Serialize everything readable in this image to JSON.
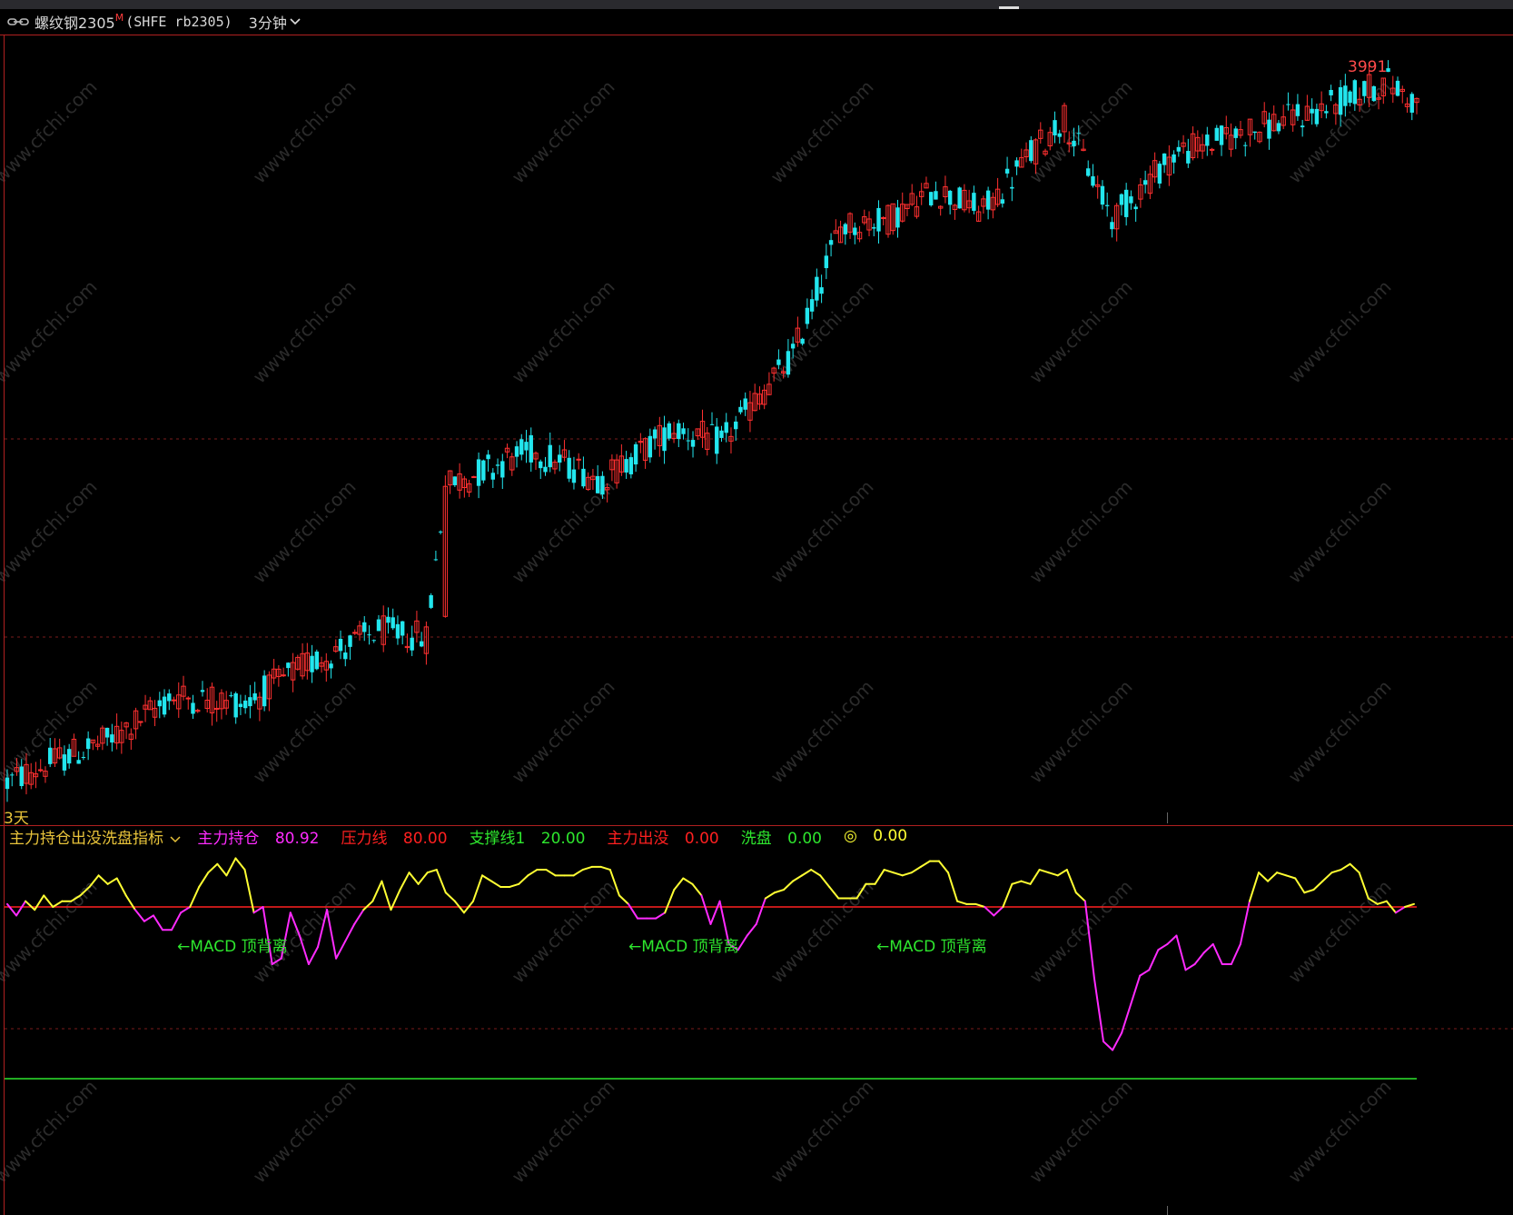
{
  "titlebar": {
    "symbol": "螺纹钢2305",
    "mark": "M",
    "code": "(SHFE rb2305)",
    "period": "3分钟",
    "link_icon": "link-icon",
    "chevron_icon": "chevron-down-icon"
  },
  "main": {
    "period_tag": "3天",
    "high_label": "3991"
  },
  "indicator": {
    "name": "主力持仓出没洗盘指标",
    "items": [
      {
        "label": "主力持仓",
        "value": "80.92",
        "color": "#ff2bff"
      },
      {
        "label": "压力线",
        "value": "80.00",
        "color": "#ff2020"
      },
      {
        "label": "支撑线1",
        "value": "20.00",
        "color": "#2ee62e"
      },
      {
        "label": "主力出没",
        "value": "0.00",
        "color": "#ff2020"
      },
      {
        "label": "洗盘",
        "value": "0.00",
        "color": "#2ee62e"
      },
      {
        "label": "◎",
        "value": "0.00",
        "color": "#ffff33"
      }
    ],
    "annotations": [
      "←MACD 顶背离",
      "←MACD 顶背离",
      "←MACD 顶背离"
    ]
  },
  "watermark": "www.cfchi.com",
  "colors": {
    "up": "#ff3030",
    "down": "#22e6ee",
    "pressure": "#ff2020",
    "support": "#2ee62e",
    "line_high": "#ffff33",
    "line_low": "#ff2bff",
    "frame": "#b02020"
  },
  "chart_data": [
    {
      "type": "candlestick",
      "title": "螺纹钢2305 (SHFE rb2305) 3分钟",
      "high_label": 3991,
      "trend_anchors": [
        [
          0,
          0.03
        ],
        [
          10,
          0.06
        ],
        [
          22,
          0.09
        ],
        [
          35,
          0.15
        ],
        [
          50,
          0.14
        ],
        [
          62,
          0.19
        ],
        [
          78,
          0.24
        ],
        [
          88,
          0.23
        ],
        [
          92,
          0.44
        ],
        [
          110,
          0.49
        ],
        [
          125,
          0.45
        ],
        [
          140,
          0.52
        ],
        [
          150,
          0.5
        ],
        [
          165,
          0.62
        ],
        [
          175,
          0.8
        ],
        [
          185,
          0.81
        ],
        [
          195,
          0.85
        ],
        [
          205,
          0.82
        ],
        [
          215,
          0.9
        ],
        [
          222,
          0.95
        ],
        [
          232,
          0.81
        ],
        [
          245,
          0.9
        ],
        [
          260,
          0.93
        ],
        [
          275,
          0.96
        ],
        [
          290,
          1.0
        ],
        [
          296,
          0.97
        ]
      ]
    },
    {
      "type": "line",
      "title": "主力持仓出没洗盘指标",
      "series": [
        {
          "name": "主力持仓",
          "values": [
            81,
            77,
            82,
            79,
            84,
            80,
            82,
            82,
            84,
            87,
            91,
            88,
            90,
            84,
            79,
            75,
            77,
            72,
            72,
            78,
            80,
            87,
            92,
            95,
            91,
            97,
            93,
            78,
            80,
            60,
            62,
            78,
            70,
            60,
            66,
            79,
            62,
            68,
            74,
            79,
            82,
            89,
            79,
            86,
            92,
            88,
            92,
            93,
            85,
            82,
            78,
            82,
            91,
            89,
            87,
            87,
            88,
            91,
            93,
            93,
            91,
            91,
            91,
            93,
            94,
            94,
            93,
            84,
            81,
            76,
            76,
            76,
            78,
            86,
            90,
            88,
            84,
            74,
            82,
            67,
            65,
            70,
            74,
            83,
            85,
            86,
            89,
            91,
            93,
            91,
            87,
            83,
            83,
            83,
            88,
            88,
            93,
            92,
            91,
            92,
            94,
            96,
            96,
            92,
            82,
            81,
            81,
            80,
            77,
            80,
            88,
            89,
            88,
            93,
            92,
            91,
            93,
            85,
            82,
            55,
            33,
            30,
            36,
            46,
            56,
            58,
            65,
            67,
            70,
            58,
            60,
            64,
            67,
            60,
            60,
            67,
            82,
            92,
            89,
            92,
            91,
            90,
            85,
            86,
            89,
            92,
            93,
            95,
            92,
            83,
            81,
            82,
            78,
            80,
            81
          ]
        }
      ],
      "reference_lines": {
        "压力线": 80,
        "支撑线1": 20
      },
      "annotations": [
        "←MACD 顶背离",
        "←MACD 顶背离",
        "←MACD 顶背离"
      ],
      "ylim": [
        0,
        100
      ]
    }
  ]
}
